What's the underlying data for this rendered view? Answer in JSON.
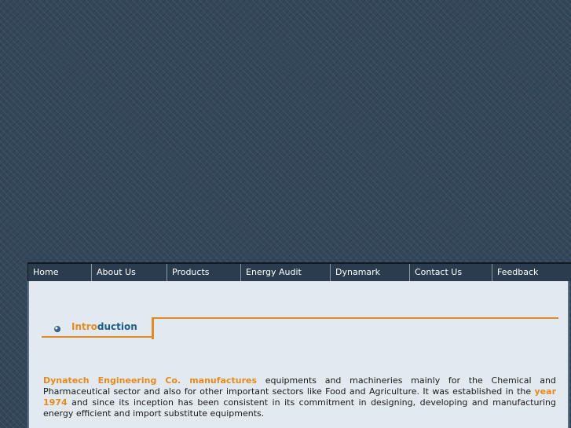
{
  "nav": {
    "items": [
      {
        "label": "Home"
      },
      {
        "label": "About Us"
      },
      {
        "label": "Products"
      },
      {
        "label": "Energy Audit"
      },
      {
        "label": "Dynamark"
      },
      {
        "label": "Contact Us"
      },
      {
        "label": "Feedback"
      }
    ]
  },
  "section": {
    "title_part1": "Intro",
    "title_part2": "duction"
  },
  "intro": {
    "company": "Dynatech Engineering Co. manufactures",
    "text1": " equipments and machineries mainly for the Chemical and Pharmaceutical sector and also for other important sectors like Food and Agriculture. It was established in the ",
    "year": "year 1974",
    "text2": " and since its inception has been consistent in its commitment in designing, developing and manufacturing energy efficient and import substitute equipments."
  },
  "colors": {
    "accent_orange": "#e68a1f",
    "accent_blue": "#1e5f8c",
    "nav_background": "#2a3c4e",
    "page_background": "#33465a",
    "content_background": "#e2eaf0"
  },
  "icons": {
    "heading_bullet": "bullet-circle-icon"
  }
}
